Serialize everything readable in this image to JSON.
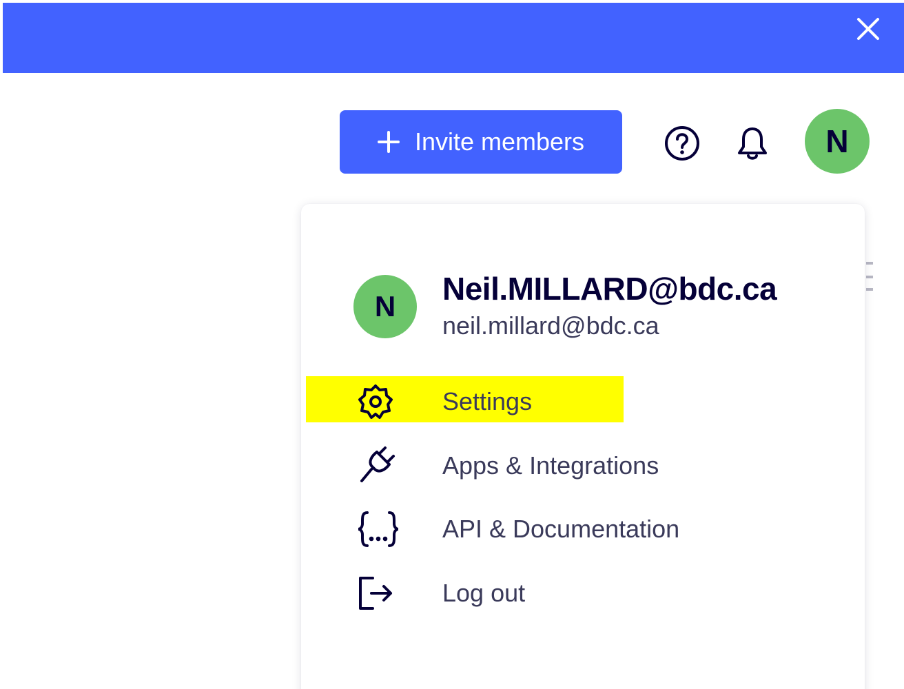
{
  "top_bar": {
    "color": "#4262ff",
    "close_icon": "close-icon"
  },
  "header": {
    "invite_button": {
      "label": "Invite members",
      "icon": "plus-icon"
    },
    "help_icon": "help-circle-icon",
    "notifications_icon": "bell-icon",
    "avatar_initial": "N",
    "avatar_color": "#6cc56a"
  },
  "account_menu": {
    "avatar_initial": "N",
    "display_name": "Neil.MILLARD@bdc.ca",
    "email": "neil.millard@bdc.ca",
    "items": [
      {
        "label": "Settings",
        "icon": "gear-icon",
        "highlighted": true
      },
      {
        "label": "Apps & Integrations",
        "icon": "plug-icon"
      },
      {
        "label": "API & Documentation",
        "icon": "code-braces-icon"
      },
      {
        "label": "Log out",
        "icon": "logout-icon"
      }
    ],
    "highlight_color": "#ffff00"
  }
}
